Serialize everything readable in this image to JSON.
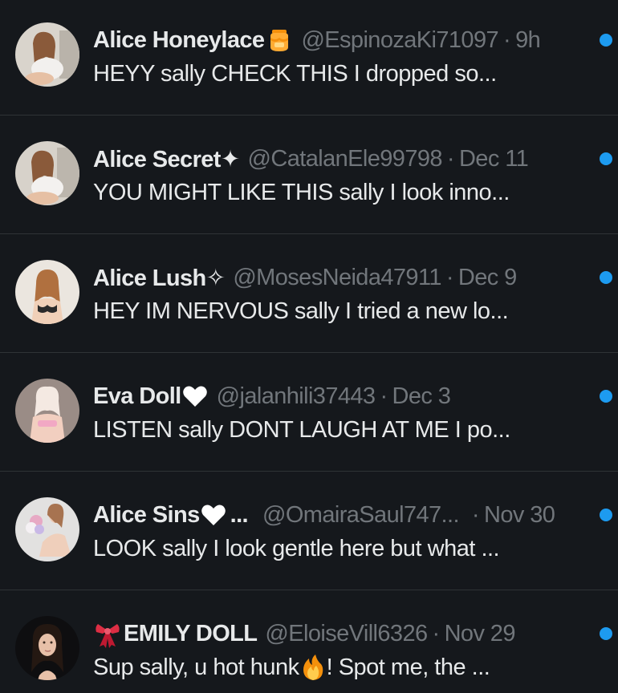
{
  "colors": {
    "background": "#15181c",
    "text_primary": "#e7e9ea",
    "text_secondary": "#71767b",
    "divider": "#2f3336",
    "unread_dot": "#1d9bf0"
  },
  "conversations": [
    {
      "name": "Alice Honeylace",
      "name_emoji": "honey-pot-icon",
      "handle": "@EspinozaKi71097",
      "separator": "·",
      "time": "9h",
      "preview": "HEYY sally CHECK THIS I dropped so...",
      "unread": true
    },
    {
      "name": "Alice Secret✦",
      "handle": "@CatalanEle99798",
      "separator": "·",
      "time": "Dec 11",
      "preview": "YOU MIGHT LIKE THIS sally I look inno...",
      "unread": true
    },
    {
      "name": "Alice Lush✧",
      "handle": "@MosesNeida47911",
      "separator": "·",
      "time": "Dec 9",
      "preview": "HEY IM NERVOUS sally I tried a new lo...",
      "unread": true
    },
    {
      "name": "Eva Doll",
      "name_emoji": "white-heart-icon",
      "handle": "@jalanhili37443",
      "separator": "·",
      "time": "Dec 3",
      "preview": "LISTEN sally DONT LAUGH AT ME I po...",
      "unread": true
    },
    {
      "name": "Alice Sins",
      "name_emoji": "white-heart-icon",
      "name_truncation": "...",
      "handle": "@OmairaSaul747...",
      "separator": "·",
      "time": "Nov 30",
      "preview": "LOOK sally I look gentle here but what ...",
      "unread": true
    },
    {
      "name_prefix_emoji": "ribbon-icon",
      "name": "EMILY DOLL",
      "handle": "@EloiseVill6326",
      "separator": "·",
      "time": "Nov 29",
      "preview_before_emoji": "Sup sally, u hot hunk",
      "preview_emoji": "fire-icon",
      "preview_after_emoji": "! Spot me, the ...",
      "unread": true
    }
  ]
}
